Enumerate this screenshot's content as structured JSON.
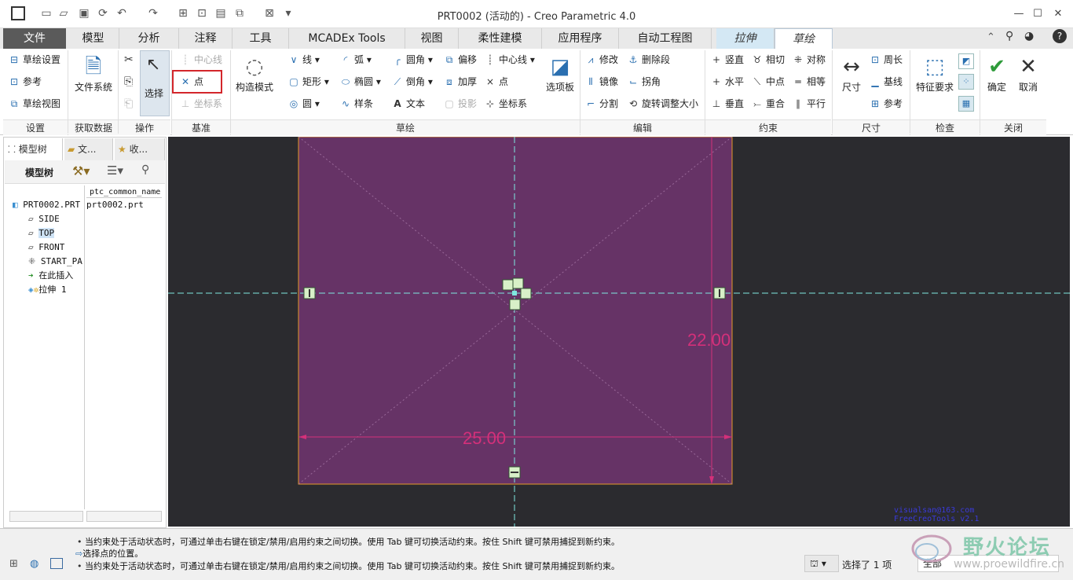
{
  "window": {
    "title": "PRT0002 (活动的) - Creo Parametric 4.0"
  },
  "colors": {
    "accent": "#d3262b",
    "sketch_bg": "#663366",
    "graphics_bg": "#2b2b2f",
    "dimension": "#d4307a",
    "centerline": "#7fe8e0"
  },
  "quick_access": {
    "icons": [
      "app-icon",
      "new-icon",
      "open-icon",
      "save-icon",
      "regenerate-icon",
      "undo-icon",
      "redo-icon",
      "regen-icon",
      "windows-icon",
      "close-window-icon",
      "customize-icon"
    ]
  },
  "tabs": {
    "file": "文件",
    "items": [
      "模型",
      "分析",
      "注释",
      "工具",
      "MCADEx Tools",
      "视图",
      "柔性建模",
      "应用程序",
      "自动工程图"
    ],
    "context": [
      "拉伸",
      "草绘"
    ]
  },
  "ribbon": {
    "setup": {
      "sketch_setup": "草绘设置",
      "reference": "参考",
      "sketch_view": "草绘视图",
      "label": "设置"
    },
    "get_data": {
      "file_system": "文件系统",
      "label": "获取数据"
    },
    "operations": {
      "select": "选择",
      "label": "操作"
    },
    "datum": {
      "centerline": "中心线",
      "point": "点",
      "csys": "坐标系",
      "label": "基准"
    },
    "sketch": {
      "construction_mode": "构造模式",
      "line": "线",
      "rectangle": "矩形",
      "circle": "圆",
      "arc": "弧",
      "ellipse": "椭圆",
      "spline": "样条",
      "fillet": "圆角",
      "chamfer": "倒角",
      "text": "文本",
      "offset": "偏移",
      "thicken": "加厚",
      "project": "投影",
      "centerline": "中心线",
      "point": "点",
      "csys": "坐标系",
      "palette": "选项板",
      "label": "草绘"
    },
    "editing": {
      "modify": "修改",
      "mirror": "镜像",
      "divide": "分割",
      "delete_segment": "删除段",
      "corner": "拐角",
      "rotate_resize": "旋转调整大小",
      "label": "编辑"
    },
    "constrain": {
      "vertical": "竖直",
      "horizontal": "水平",
      "perpendicular": "垂直",
      "tangent": "相切",
      "midpoint": "中点",
      "coincident": "重合",
      "symmetric": "对称",
      "equal": "相等",
      "parallel": "平行",
      "label": "约束"
    },
    "dimension": {
      "dimension": "尺寸",
      "perimeter": "周长",
      "baseline": "基线",
      "reference": "参考",
      "label": "尺寸"
    },
    "inspect": {
      "feature_requirements": "特征要求",
      "label": "检查"
    },
    "close": {
      "ok": "确定",
      "cancel": "取消",
      "label": "关闭"
    }
  },
  "sidebar": {
    "tabs": [
      "模型树",
      "文...",
      "收..."
    ],
    "header": "模型树",
    "column": "ptc_common_name",
    "rows": [
      {
        "name": "PRT0002.PRT",
        "value": "prt0002.prt"
      },
      {
        "name": "SIDE"
      },
      {
        "name": "TOP"
      },
      {
        "name": "FRONT"
      },
      {
        "name": "START_PA"
      },
      {
        "name": "在此插入"
      },
      {
        "name": "拉伸 1"
      }
    ]
  },
  "graphics": {
    "dim_h": "25.00",
    "dim_v": "22.00",
    "watermark1": "visualsan@163.com",
    "watermark2": "FreeCreoTools v2.1"
  },
  "status": {
    "line1": "当约束处于活动状态时，可通过单击右键在锁定/禁用/启用约束之间切换。使用 Tab 键可切换活动约束。按住 Shift 键可禁用捕捉到新约束。",
    "line2": "选择点的位置。",
    "line3": "当约束处于活动状态时，可通过单击右键在锁定/禁用/启用约束之间切换。使用 Tab 键可切换活动约束。按住 Shift 键可禁用捕捉到新约束。",
    "selection": "选择了 1 项",
    "filter": "全部",
    "forum": "野火论坛",
    "forum_url": "www.proewildfire.cn"
  }
}
